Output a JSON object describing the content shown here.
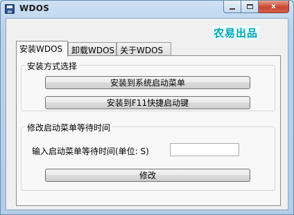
{
  "window": {
    "title": "WDOS",
    "caption": {
      "minimize": "",
      "maximize": "",
      "close": "x"
    }
  },
  "brand": {
    "text": "农易出品",
    "color": "#00a7b5"
  },
  "tabs": [
    {
      "label": "安装WDOS",
      "active": true
    },
    {
      "label": "卸载WDOS",
      "active": false
    },
    {
      "label": "关于WDOS",
      "active": false
    }
  ],
  "install_group": {
    "legend": "安装方式选择",
    "btn_system_menu": "安装到系统启动菜单",
    "btn_f11": "安装到F11快捷启动键"
  },
  "wait_group": {
    "legend": "修改启动菜单等待时间",
    "input_label": "输入启动菜单等待时间(单位: S)",
    "input_value": "",
    "btn_modify": "修改"
  },
  "colors": {
    "accent": "#00a7b5",
    "window_frame": "#b9d3ec",
    "close_button": "#c9452f"
  },
  "icons": {
    "app": "floppy-disk-icon"
  }
}
